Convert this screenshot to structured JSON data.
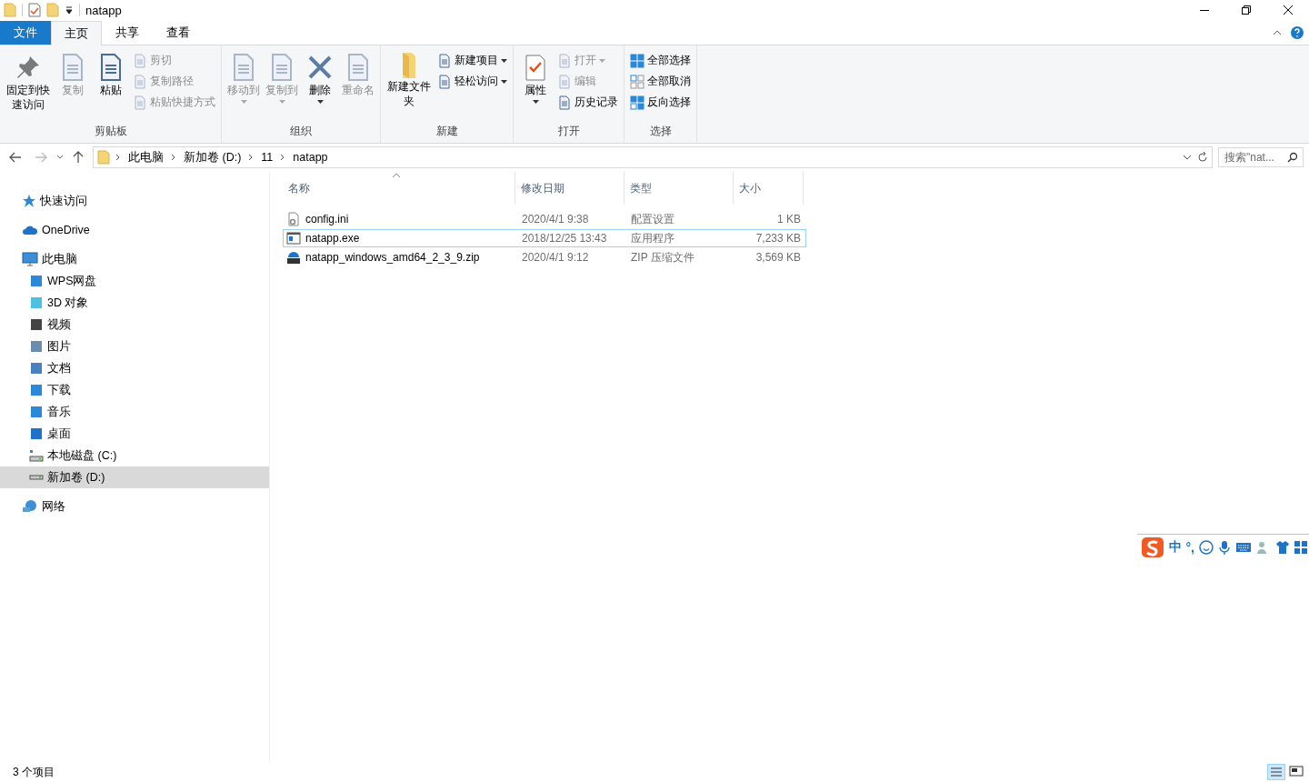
{
  "window": {
    "title": "natapp"
  },
  "ribbon_tabs": [
    {
      "label": "文件",
      "kind": "file",
      "selected": false
    },
    {
      "label": "主页",
      "kind": "tab",
      "selected": true
    },
    {
      "label": "共享",
      "kind": "tab",
      "selected": false
    },
    {
      "label": "查看",
      "kind": "tab",
      "selected": false
    }
  ],
  "ribbon_groups": [
    {
      "label": "剪贴板",
      "items": [
        {
          "label": "固定到快速访问",
          "kind": "large",
          "disabled": false,
          "dropdown": false
        },
        {
          "label": "复制",
          "kind": "large",
          "disabled": true,
          "dropdown": false
        },
        {
          "label": "粘贴",
          "kind": "large",
          "disabled": false,
          "dropdown": false
        },
        {
          "label": "剪切",
          "kind": "small",
          "disabled": true,
          "dropdown": false
        },
        {
          "label": "复制路径",
          "kind": "small",
          "disabled": true,
          "dropdown": false
        },
        {
          "label": "粘贴快捷方式",
          "kind": "small",
          "disabled": true,
          "dropdown": false
        }
      ]
    },
    {
      "label": "组织",
      "items": [
        {
          "label": "移动到",
          "kind": "large",
          "disabled": true,
          "dropdown": true
        },
        {
          "label": "复制到",
          "kind": "large",
          "disabled": true,
          "dropdown": true
        },
        {
          "label": "删除",
          "kind": "large",
          "disabled": false,
          "dropdown": true
        },
        {
          "label": "重命名",
          "kind": "large",
          "disabled": true,
          "dropdown": false
        }
      ]
    },
    {
      "label": "新建",
      "items": [
        {
          "label": "新建文件夹",
          "kind": "large",
          "disabled": false,
          "dropdown": false
        },
        {
          "label": "新建项目",
          "kind": "small",
          "disabled": false,
          "dropdown": true
        },
        {
          "label": "轻松访问",
          "kind": "small",
          "disabled": false,
          "dropdown": true
        }
      ]
    },
    {
      "label": "打开",
      "items": [
        {
          "label": "属性",
          "kind": "large",
          "disabled": false,
          "dropdown": true
        },
        {
          "label": "打开",
          "kind": "small",
          "disabled": true,
          "dropdown": true
        },
        {
          "label": "编辑",
          "kind": "small",
          "disabled": true,
          "dropdown": false
        },
        {
          "label": "历史记录",
          "kind": "small",
          "disabled": false,
          "dropdown": false
        }
      ]
    },
    {
      "label": "选择",
      "items": [
        {
          "label": "全部选择",
          "kind": "small",
          "disabled": false,
          "dropdown": false
        },
        {
          "label": "全部取消",
          "kind": "small",
          "disabled": false,
          "dropdown": false
        },
        {
          "label": "反向选择",
          "kind": "small",
          "disabled": false,
          "dropdown": false
        }
      ]
    }
  ],
  "address_bar": {
    "path": [
      "此电脑",
      "新加卷 (D:)",
      "11",
      "natapp"
    ]
  },
  "search": {
    "placeholder": "搜索\"nat..."
  },
  "sidebar": {
    "items": [
      {
        "label": "快速访问",
        "selected": false
      },
      {
        "label": "OneDrive",
        "selected": false
      },
      {
        "label": "此电脑",
        "selected": false,
        "children": [
          {
            "label": "WPS网盘",
            "selected": false
          },
          {
            "label": "3D 对象",
            "selected": false
          },
          {
            "label": "视频",
            "selected": false
          },
          {
            "label": "图片",
            "selected": false
          },
          {
            "label": "文档",
            "selected": false
          },
          {
            "label": "下载",
            "selected": false
          },
          {
            "label": "音乐",
            "selected": false
          },
          {
            "label": "桌面",
            "selected": false
          },
          {
            "label": "本地磁盘 (C:)",
            "selected": false
          },
          {
            "label": "新加卷 (D:)",
            "selected": true
          }
        ]
      },
      {
        "label": "网络",
        "selected": false
      }
    ]
  },
  "table": {
    "columns": [
      {
        "label": "名称",
        "sorted": true
      },
      {
        "label": "修改日期",
        "sorted": false
      },
      {
        "label": "类型",
        "sorted": false
      },
      {
        "label": "大小",
        "sorted": false
      }
    ],
    "rows": [
      {
        "name": "config.ini",
        "date": "2020/4/1 9:38",
        "type": "配置设置",
        "size": "1 KB",
        "kind": "ini",
        "focused": false
      },
      {
        "name": "natapp.exe",
        "date": "2018/12/25 13:43",
        "type": "应用程序",
        "size": "7,233 KB",
        "kind": "exe",
        "focused": true
      },
      {
        "name": "natapp_windows_amd64_2_3_9.zip",
        "date": "2020/4/1 9:12",
        "type": "ZIP 压缩文件",
        "size": "3,569 KB",
        "kind": "zip",
        "focused": false
      }
    ]
  },
  "ime_toolbar": {
    "mode": "中",
    "punctuation": "°,"
  },
  "status_bar": {
    "count": "3 个项目"
  }
}
